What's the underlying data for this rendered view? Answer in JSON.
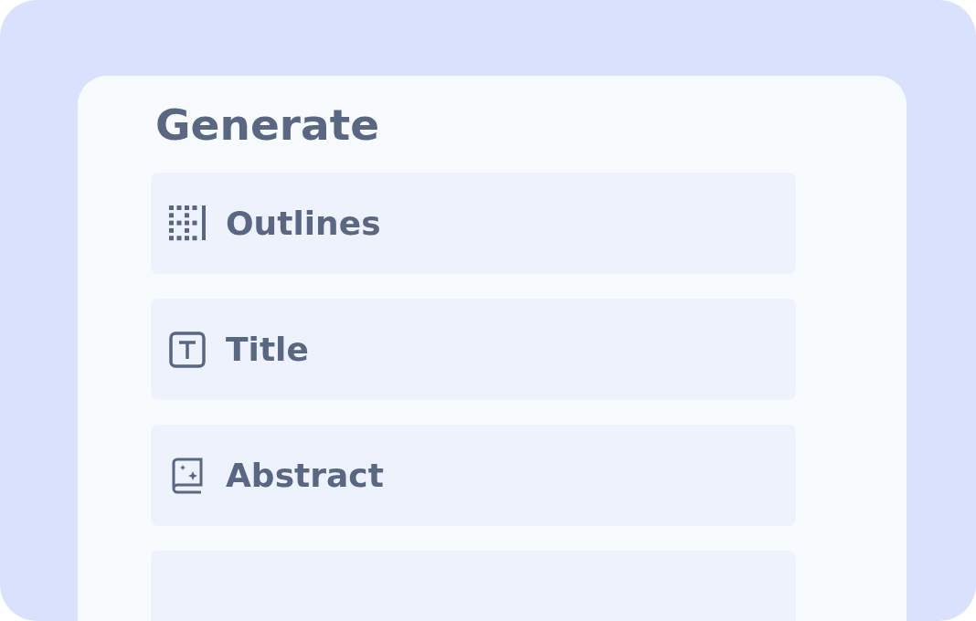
{
  "heading": "Generate",
  "items": [
    {
      "label": "Outlines",
      "kind": "grid"
    },
    {
      "label": "Title",
      "kind": "text"
    },
    {
      "label": "Abstract",
      "kind": "book"
    }
  ]
}
